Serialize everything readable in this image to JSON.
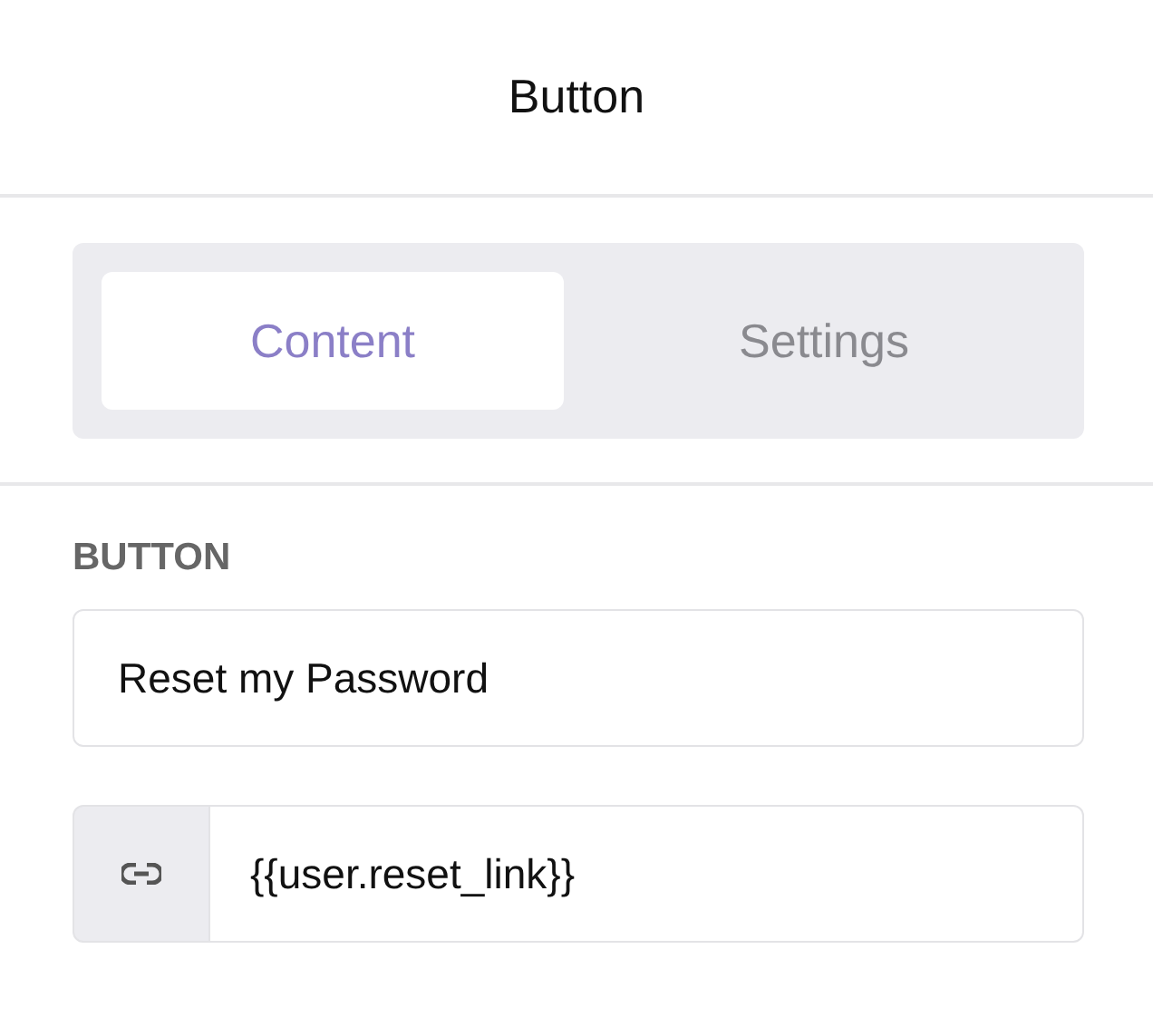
{
  "header": {
    "title": "Button"
  },
  "tabs": [
    {
      "label": "Content",
      "selected": true
    },
    {
      "label": "Settings",
      "selected": false
    }
  ],
  "section": {
    "label": "BUTTON"
  },
  "fields": [
    {
      "kind": "text",
      "value": "Reset my Password"
    },
    {
      "kind": "link",
      "value": "{{user.reset_link}}"
    }
  ]
}
